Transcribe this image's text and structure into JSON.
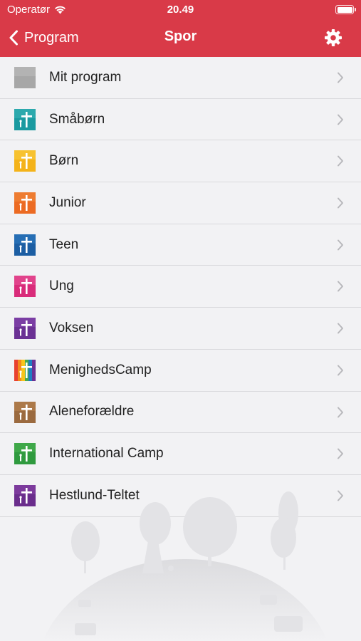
{
  "status": {
    "carrier": "Operatør",
    "time": "20.49"
  },
  "nav": {
    "back_label": "Program",
    "title": "Spor"
  },
  "colors": {
    "header": "#d93a48",
    "background": "#f2f2f4"
  },
  "tracks": [
    {
      "label": "Mit program",
      "icon": "gray-square-icon",
      "color": "#a7a7a7",
      "color2": "#bdbdbd"
    },
    {
      "label": "Småbørn",
      "icon": "smaaboern-track-icon",
      "color": "#1a9aa0",
      "color2": "#3db6b8"
    },
    {
      "label": "Børn",
      "icon": "boern-track-icon",
      "color": "#f4b31a",
      "color2": "#f9cd43"
    },
    {
      "label": "Junior",
      "icon": "junior-track-icon",
      "color": "#ec6b23",
      "color2": "#f08a3e"
    },
    {
      "label": "Teen",
      "icon": "teen-track-icon",
      "color": "#1c5ea3",
      "color2": "#2f7cc2"
    },
    {
      "label": "Ung",
      "icon": "ung-track-icon",
      "color": "#d92c7a",
      "color2": "#e85799"
    },
    {
      "label": "Voksen",
      "icon": "voksen-track-icon",
      "color": "#6b3194",
      "color2": "#8848b0"
    },
    {
      "label": "MenighedsCamp",
      "icon": "menighedscamp-track-icon",
      "color": "rainbow",
      "color2": ""
    },
    {
      "label": "Aleneforældre",
      "icon": "aleneforaeldre-track-icon",
      "color": "#9b6a3f",
      "color2": "#b98552"
    },
    {
      "label": "International Camp",
      "icon": "international-camp-track-icon",
      "color": "#2f9a3e",
      "color2": "#4db452"
    },
    {
      "label": "Hestlund-Teltet",
      "icon": "hestlund-teltet-track-icon",
      "color": "#6a2d8c",
      "color2": "#8a45aa"
    }
  ]
}
